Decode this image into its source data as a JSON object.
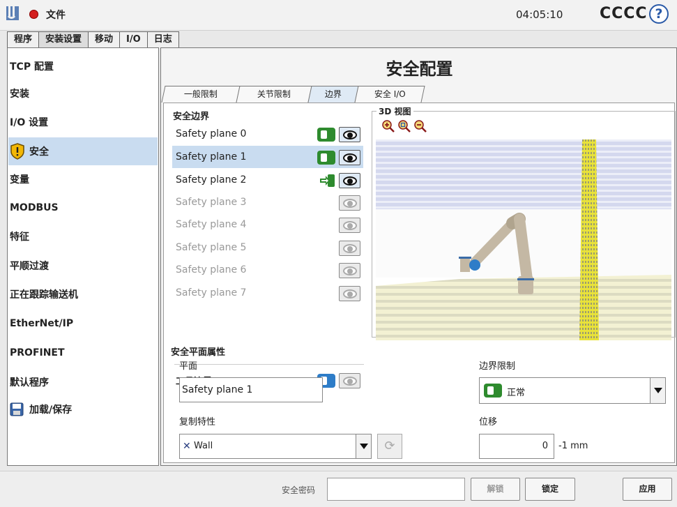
{
  "topbar": {
    "file_menu": "文件",
    "clock": "04:05:10",
    "robot_name": "CCCC",
    "help_glyph": "?"
  },
  "main_tabs": [
    {
      "label": "程序",
      "active": false
    },
    {
      "label": "安装设置",
      "active": true
    },
    {
      "label": "移动",
      "active": false
    },
    {
      "label": "I/O",
      "active": false
    },
    {
      "label": "日志",
      "active": false
    }
  ],
  "sidebar": {
    "items": [
      {
        "label": "TCP 配置"
      },
      {
        "label": "安装"
      },
      {
        "label": "I/O 设置"
      },
      {
        "label": "安全",
        "icon": "warning-shield-icon",
        "selected": true
      },
      {
        "label": "变量"
      },
      {
        "label": "MODBUS"
      },
      {
        "label": "特征"
      },
      {
        "label": "平顺过渡"
      },
      {
        "label": "正在跟踪输送机"
      },
      {
        "label": "EtherNet/IP"
      },
      {
        "label": "PROFINET"
      },
      {
        "label": "默认程序"
      },
      {
        "label": "加载/保存",
        "icon": "save-disk-icon"
      }
    ]
  },
  "page": {
    "title": "安全配置",
    "sub_tabs": [
      {
        "label": "一般限制",
        "active": false
      },
      {
        "label": "关节限制",
        "active": false
      },
      {
        "label": "边界",
        "active": true
      },
      {
        "label": "安全 I/O",
        "active": false
      }
    ]
  },
  "boundaries": {
    "title": "安全边界",
    "planes": [
      {
        "label": "Safety plane 0",
        "enabled": true,
        "mode": "normal",
        "visible": true
      },
      {
        "label": "Safety plane 1",
        "enabled": true,
        "mode": "normal",
        "visible": true,
        "selected": true
      },
      {
        "label": "Safety plane 2",
        "enabled": true,
        "mode": "trigger",
        "visible": true
      },
      {
        "label": "Safety plane 3",
        "enabled": false
      },
      {
        "label": "Safety plane 4",
        "enabled": false
      },
      {
        "label": "Safety plane 5",
        "enabled": false
      },
      {
        "label": "Safety plane 6",
        "enabled": false
      },
      {
        "label": "Safety plane 7",
        "enabled": false
      }
    ],
    "tool_boundary": "工具边界"
  },
  "view3d": {
    "label": "3D 视图",
    "zoom_in": "zoom-in-icon",
    "zoom_reset": "zoom-fit-icon",
    "zoom_out": "zoom-out-icon"
  },
  "props": {
    "title": "安全平面属性",
    "plane_label": "平面",
    "plane_value": "Safety plane 1",
    "limit_label": "边界限制",
    "limit_value": "正常",
    "copy_label": "复制特性",
    "copy_value": "Wall",
    "offset_label": "位移",
    "offset_value": "0",
    "offset_unit": "-1 mm"
  },
  "bottom": {
    "password_label": "安全密码",
    "unlock": "解锁",
    "lock": "锁定",
    "apply": "应用"
  },
  "colors": {
    "accent_green": "#2e8b2e",
    "selection_blue": "#c9dcf0",
    "help_blue": "#2a5aa8"
  }
}
